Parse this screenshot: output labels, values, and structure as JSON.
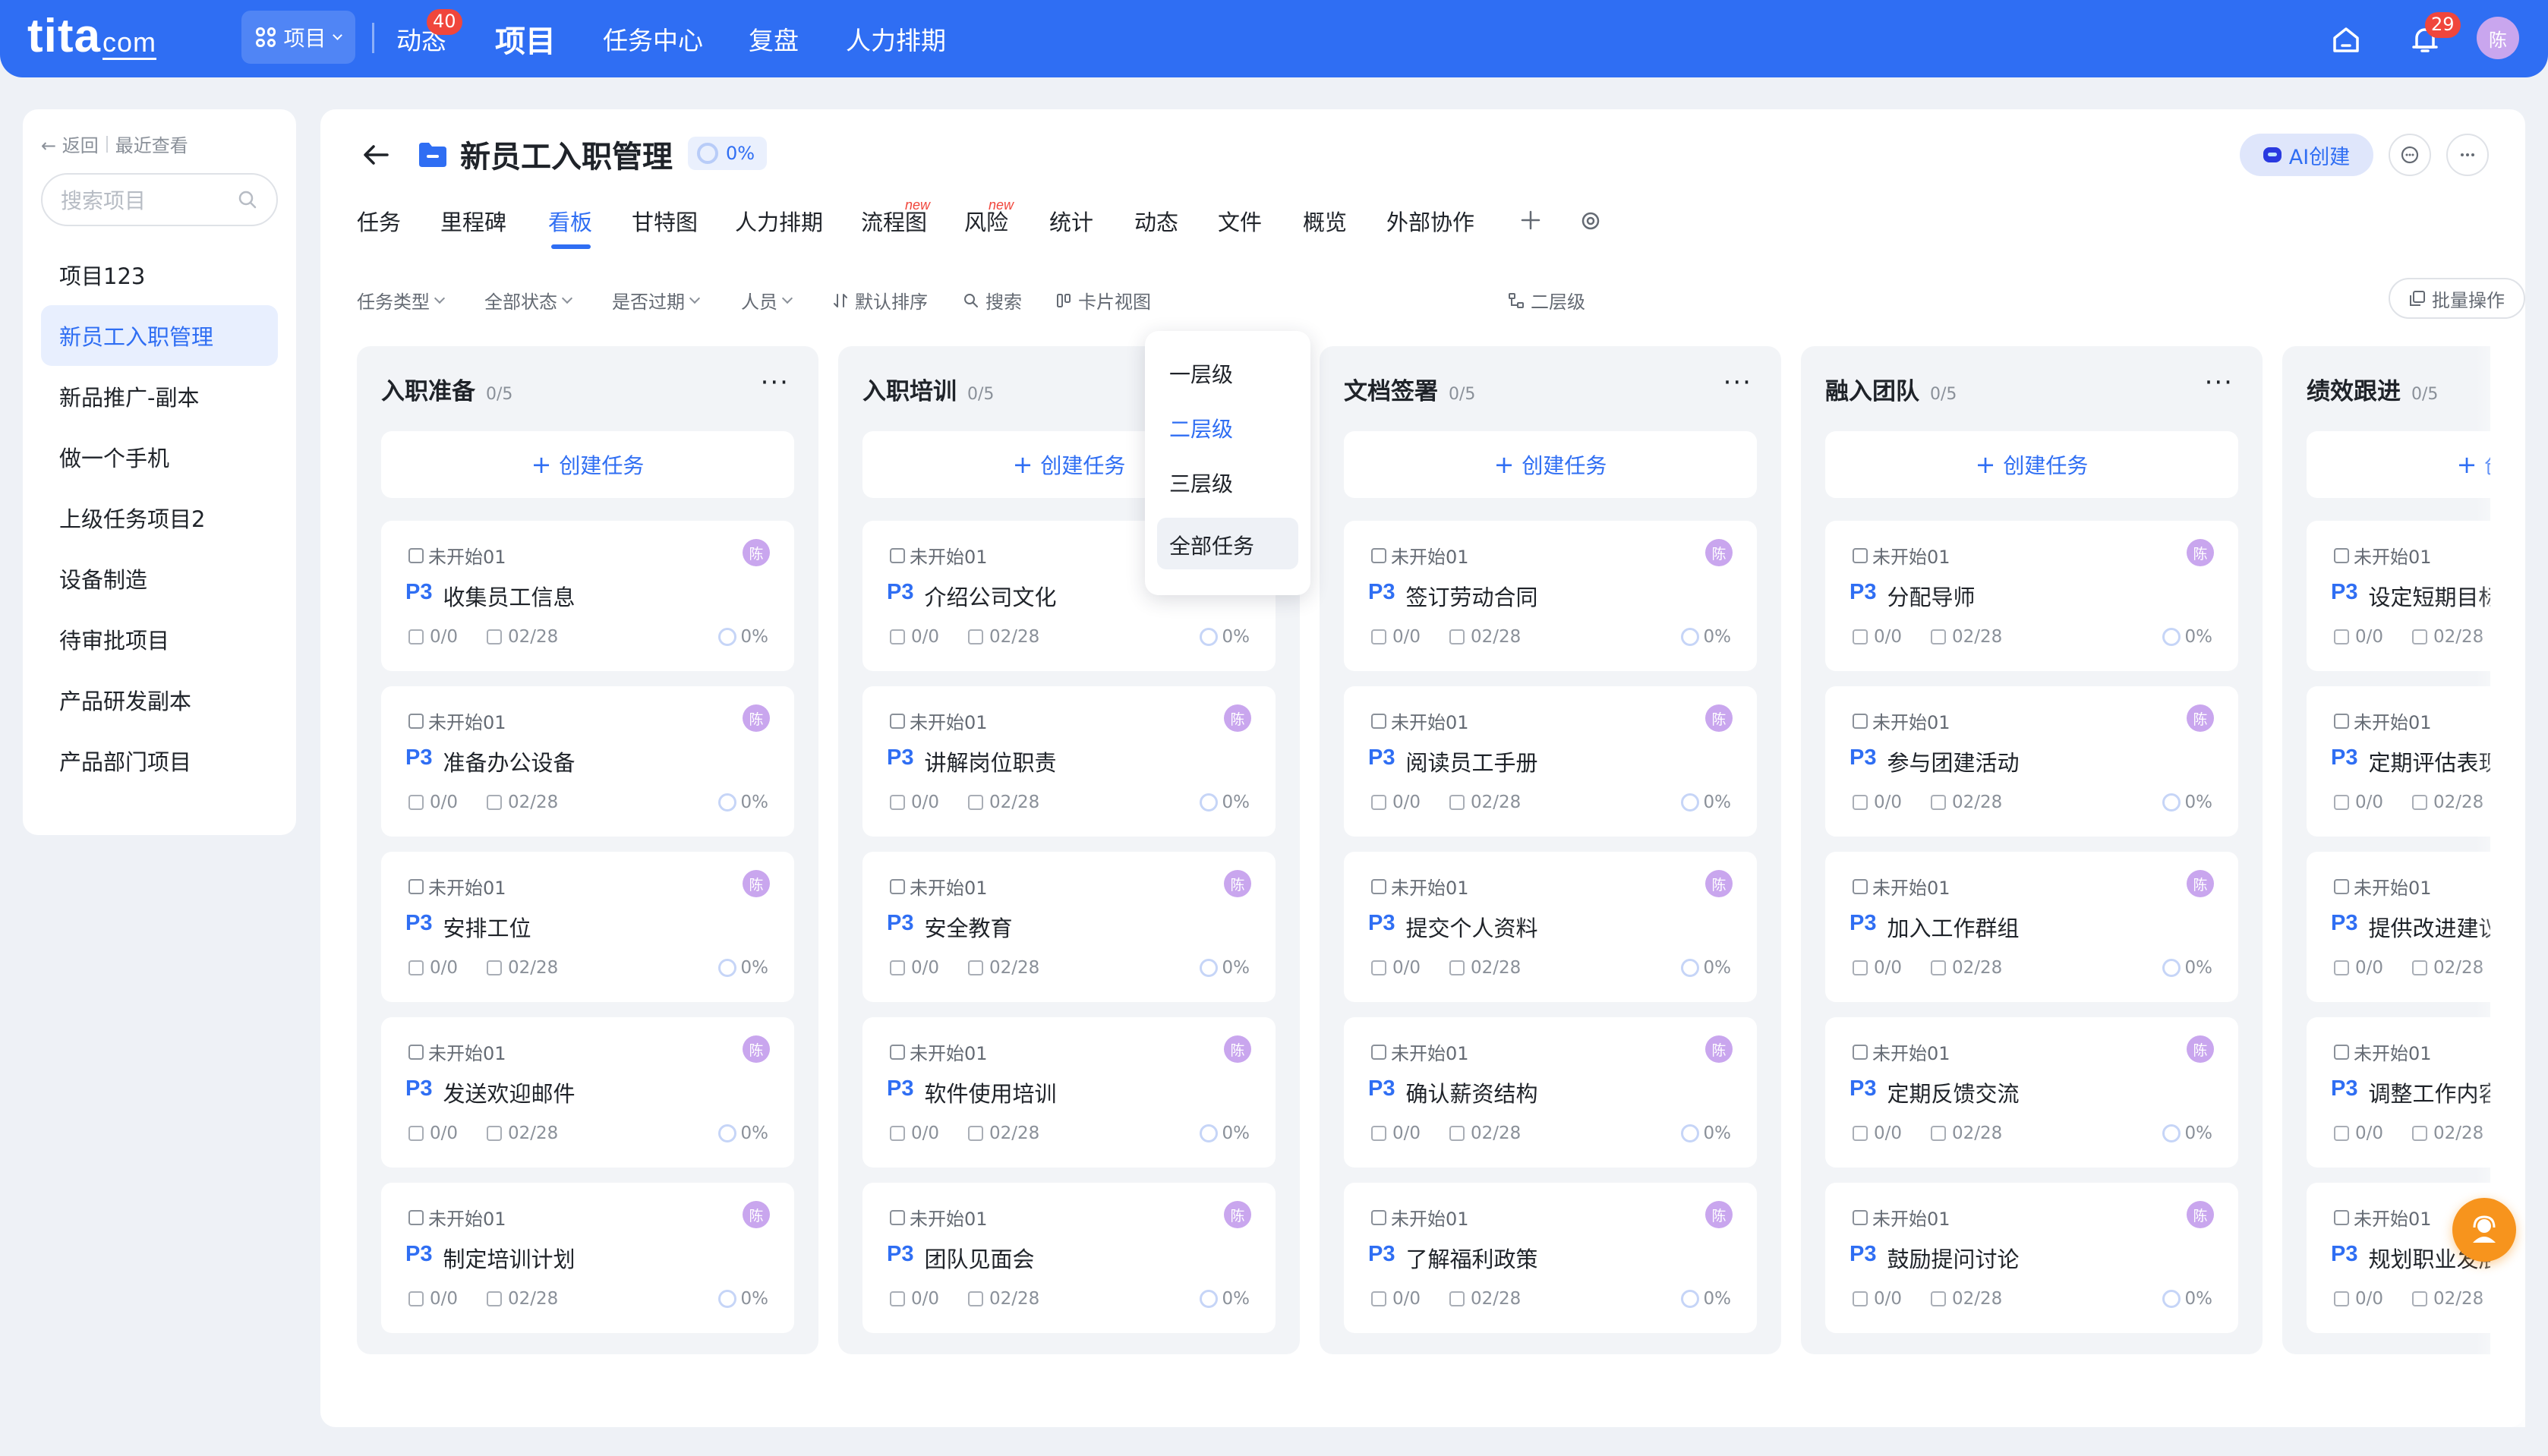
{
  "topbar": {
    "logo": "tita",
    "logo_suffix": "com",
    "project_switch": "项目",
    "nav": [
      {
        "label": "动态",
        "badge": "40"
      },
      {
        "label": "项目",
        "active": true
      },
      {
        "label": "任务中心"
      },
      {
        "label": "复盘"
      },
      {
        "label": "人力排期"
      }
    ],
    "bell_badge": "29",
    "avatar": "陈"
  },
  "sidebar": {
    "back": "返回",
    "recent": "最近查看",
    "search_placeholder": "搜索项目",
    "items": [
      "项目123",
      "新员工入职管理",
      "新品推广-副本",
      "做一个手机",
      "上级任务项目2",
      "设备制造",
      "待审批项目",
      "产品研发副本",
      "产品部门项目"
    ],
    "active_index": 1
  },
  "header": {
    "title": "新员工入职管理",
    "progress": "0%",
    "ai_button": "AI创建",
    "tabs": [
      "任务",
      "里程碑",
      "看板",
      "甘特图",
      "人力排期",
      "流程图",
      "风险",
      "统计",
      "动态",
      "文件",
      "概览",
      "外部协作"
    ],
    "active_tab": 2,
    "new_tag": "new"
  },
  "filters": {
    "task_type": "任务类型",
    "all_status": "全部状态",
    "overdue": "是否过期",
    "people": "人员",
    "sort": "默认排序",
    "search": "搜索",
    "card_view": "卡片视图",
    "level": "二层级",
    "batch": "批量操作"
  },
  "dropdown": {
    "options": [
      "一层级",
      "二层级",
      "三层级",
      "全部任务"
    ],
    "selected": "二层级"
  },
  "board": {
    "create_label": "创建任务",
    "card_status": "未开始01",
    "priority": "P3",
    "subtasks": "0/0",
    "due": "02/28",
    "progress": "0%",
    "assignee": "陈",
    "columns": [
      {
        "title": "入职准备",
        "count": "0/5",
        "tasks": [
          "收集员工信息",
          "准备办公设备",
          "安排工位",
          "发送欢迎邮件",
          "制定培训计划"
        ]
      },
      {
        "title": "入职培训",
        "count": "0/5",
        "tasks": [
          "介绍公司文化",
          "讲解岗位职责",
          "安全教育",
          "软件使用培训",
          "团队见面会"
        ]
      },
      {
        "title": "文档签署",
        "count": "0/5",
        "tasks": [
          "签订劳动合同",
          "阅读员工手册",
          "提交个人资料",
          "确认薪资结构",
          "了解福利政策"
        ]
      },
      {
        "title": "融入团队",
        "count": "0/5",
        "tasks": [
          "分配导师",
          "参与团建活动",
          "加入工作群组",
          "定期反馈交流",
          "鼓励提问讨论"
        ]
      },
      {
        "title": "绩效跟进",
        "count": "0/5",
        "tasks": [
          "设定短期目标",
          "定期评估表现",
          "提供改进建议",
          "调整工作内容",
          "规划职业发展"
        ]
      }
    ]
  },
  "colors": {
    "brand": "#2f6ef3",
    "badge": "#f0463c",
    "avatar": "#c9a6ee",
    "help": "#f7941d"
  },
  "icons": [
    "grid-icon",
    "home-icon",
    "bell-icon",
    "search-icon",
    "back-arrow-icon",
    "folder-icon",
    "comment-icon",
    "more-icon",
    "plus-icon",
    "settings-icon",
    "sort-icon",
    "card-view-icon",
    "tree-icon",
    "batch-icon",
    "checkbox-icon",
    "calendar-icon",
    "help-icon"
  ]
}
